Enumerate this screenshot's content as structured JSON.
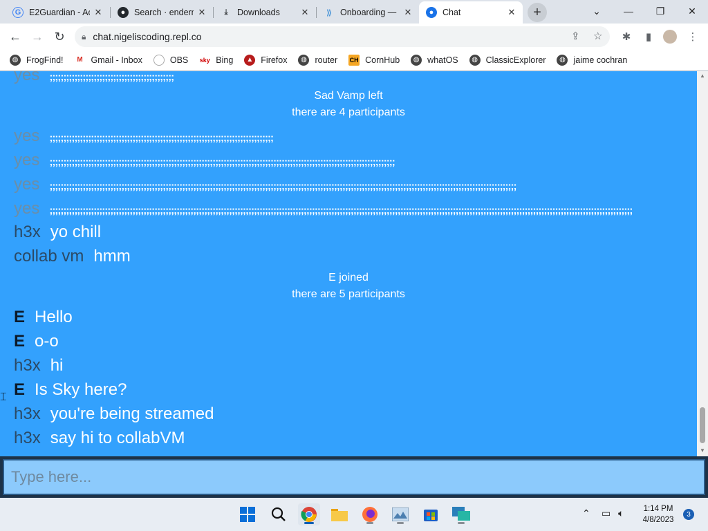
{
  "tabs": [
    {
      "label": "E2Guardian - Ac",
      "icon": "google-icon",
      "active": false
    },
    {
      "label": "Search · enderm",
      "icon": "github-icon",
      "active": false
    },
    {
      "label": "Downloads",
      "icon": "download-icon",
      "active": false
    },
    {
      "label": "Onboarding —",
      "icon": "onboarding-icon",
      "active": false
    },
    {
      "label": "Chat",
      "icon": "chat-icon",
      "active": true
    }
  ],
  "address": {
    "url": "chat.nigeliscoding.repl.co"
  },
  "bookmarks": [
    {
      "label": "FrogFind!",
      "icon": "globe-icon"
    },
    {
      "label": "Gmail - Inbox",
      "icon": "gmail-icon"
    },
    {
      "label": "OBS",
      "icon": "github-icon"
    },
    {
      "label": "Bing",
      "icon": "sky-icon"
    },
    {
      "label": "Firefox",
      "icon": "firefox-icon"
    },
    {
      "label": "router",
      "icon": "globe-icon"
    },
    {
      "label": "CornHub",
      "icon": "ch-icon"
    },
    {
      "label": "whatOS",
      "icon": "globe-icon"
    },
    {
      "label": "ClassicExplorer",
      "icon": "globe-icon"
    },
    {
      "label": "jaime cochran",
      "icon": "globe-icon"
    }
  ],
  "chat": {
    "messages": [
      {
        "user": "yes",
        "text": ";;;;;;;;;;;;;;;;;;;;;;;;;;;;;;;;;;;;;;;;;;;;;",
        "style": "faded"
      },
      {
        "user": "yes",
        "text": ";;;;;;;;;;;;;;;;;;;;;;;;;;;;;;;;;;;;;;;;;;;;;;;;;;;;;;;;;;;;;;;;;;;;;;;;;;;;;;;;;",
        "style": "faded"
      },
      {
        "user": "yes",
        "text": ";;;;;;;;;;;;;;;;;;;;;;;;;;;;;;;;;;;;;;;;;;;;;;;;;;;;;;;;;;;;;;;;;;;;;;;;;;;;;;;;;;;;;;;;;;;;;;;;;;;;;;;;;;;;;;;;;;;;;;;;;;;;;",
        "style": "faded"
      },
      {
        "user": "yes",
        "text": ";;;;;;;;;;;;;;;;;;;;;;;;;;;;;;;;;;;;;;;;;;;;;;;;;;;;;;;;;;;;;;;;;;;;;;;;;;;;;;;;;;;;;;;;;;;;;;;;;;;;;;;;;;;;;;;;;;;;;;;;;;;;;;;;;;;;;;;;;;;;;;;;;;;;;;;;;;;;;;;;;;;;;;;;;",
        "style": "faded"
      },
      {
        "user": "yes",
        "text": ";;;;;;;;;;;;;;;;;;;;;;;;;;;;;;;;;;;;;;;;;;;;;;;;;;;;;;;;;;;;;;;;;;;;;;;;;;;;;;;;;;;;;;;;;;;;;;;;;;;;;;;;;;;;;;;;;;;;;;;;;;;;;;;;;;;;;;;;;;;;;;;;;;;;;;;;;;;;;;;;;;;;;;;;;;;;;;;;;;;;;;;;;;;;;;;;;;;;;;;;;;;;;;;;;;;",
        "style": "faded"
      },
      {
        "user": "h3x",
        "text": "yo chill",
        "style": "dark"
      },
      {
        "user": "collab vm",
        "text": "hmm",
        "style": "dark"
      },
      {
        "user": "E",
        "text": "Hello",
        "style": "black"
      },
      {
        "user": "E",
        "text": "o-o",
        "style": "black"
      },
      {
        "user": "h3x",
        "text": "hi",
        "style": "dark"
      },
      {
        "user": "E",
        "text": "Is Sky here?",
        "style": "black"
      },
      {
        "user": "h3x",
        "text": "you're being streamed",
        "style": "dark"
      },
      {
        "user": "h3x",
        "text": "say hi to collabVM",
        "style": "dark"
      }
    ],
    "notices": [
      {
        "line1": "Sad Vamp left",
        "line2": "there are 4 participants"
      },
      {
        "line1": "E joined",
        "line2": "there are 5 participants"
      }
    ],
    "input_placeholder": "Type here..."
  },
  "taskbar": {
    "time": "1:14 PM",
    "date": "4/8/2023",
    "notification_count": "3"
  },
  "colors": {
    "page_bg": "#33a1fd",
    "input_bg": "#8ccafc",
    "input_bar": "#1d3248"
  }
}
